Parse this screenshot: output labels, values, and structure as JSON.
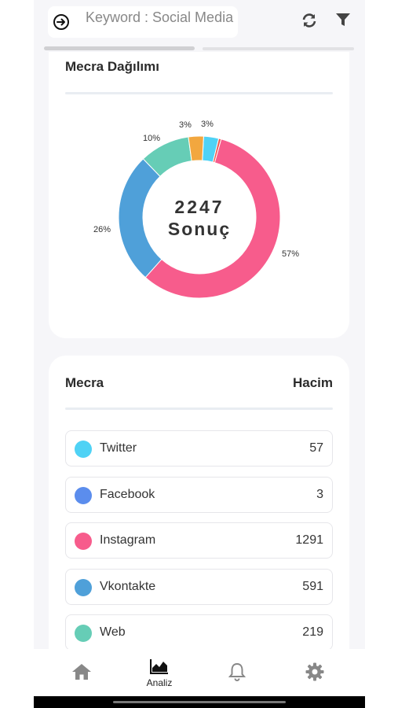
{
  "header": {
    "search_text": "Keyword : Social Media"
  },
  "distribution": {
    "title": "Mecra Dağılımı",
    "total_value": "2247",
    "total_label": "Sonuç",
    "colors": {
      "twitter": "#4fd2f5",
      "facebook": "#f0554a",
      "instagram": "#f75c8c",
      "vkontakte": "#4fa0d9",
      "web": "#66cdb6",
      "other": "#f2a73f"
    }
  },
  "chart_data": {
    "type": "pie",
    "labels": [
      "3%",
      "3%",
      "10%",
      "26%",
      "57%"
    ],
    "slices": [
      {
        "color": "twitter",
        "value": 3
      },
      {
        "color": "facebook",
        "value": 0.5
      },
      {
        "color": "instagram",
        "value": 57
      },
      {
        "color": "vkontakte",
        "value": 26
      },
      {
        "color": "web",
        "value": 10
      },
      {
        "color": "other",
        "value": 3
      }
    ]
  },
  "list": {
    "header_left": "Mecra",
    "header_right": "Hacim",
    "rows": [
      {
        "name": "Twitter",
        "value": "57",
        "color": "#4fd2f5"
      },
      {
        "name": "Facebook",
        "value": "3",
        "color": "#5b8ded"
      },
      {
        "name": "Instagram",
        "value": "1291",
        "color": "#f75c8c"
      },
      {
        "name": "Vkontakte",
        "value": "591",
        "color": "#4fa0d9"
      },
      {
        "name": "Web",
        "value": "219",
        "color": "#66cdb6"
      }
    ]
  },
  "nav": {
    "items": [
      {
        "icon": "home-icon",
        "label": ""
      },
      {
        "icon": "chart-icon",
        "label": "Analiz"
      },
      {
        "icon": "bell-icon",
        "label": ""
      },
      {
        "icon": "gear-icon",
        "label": ""
      }
    ]
  }
}
